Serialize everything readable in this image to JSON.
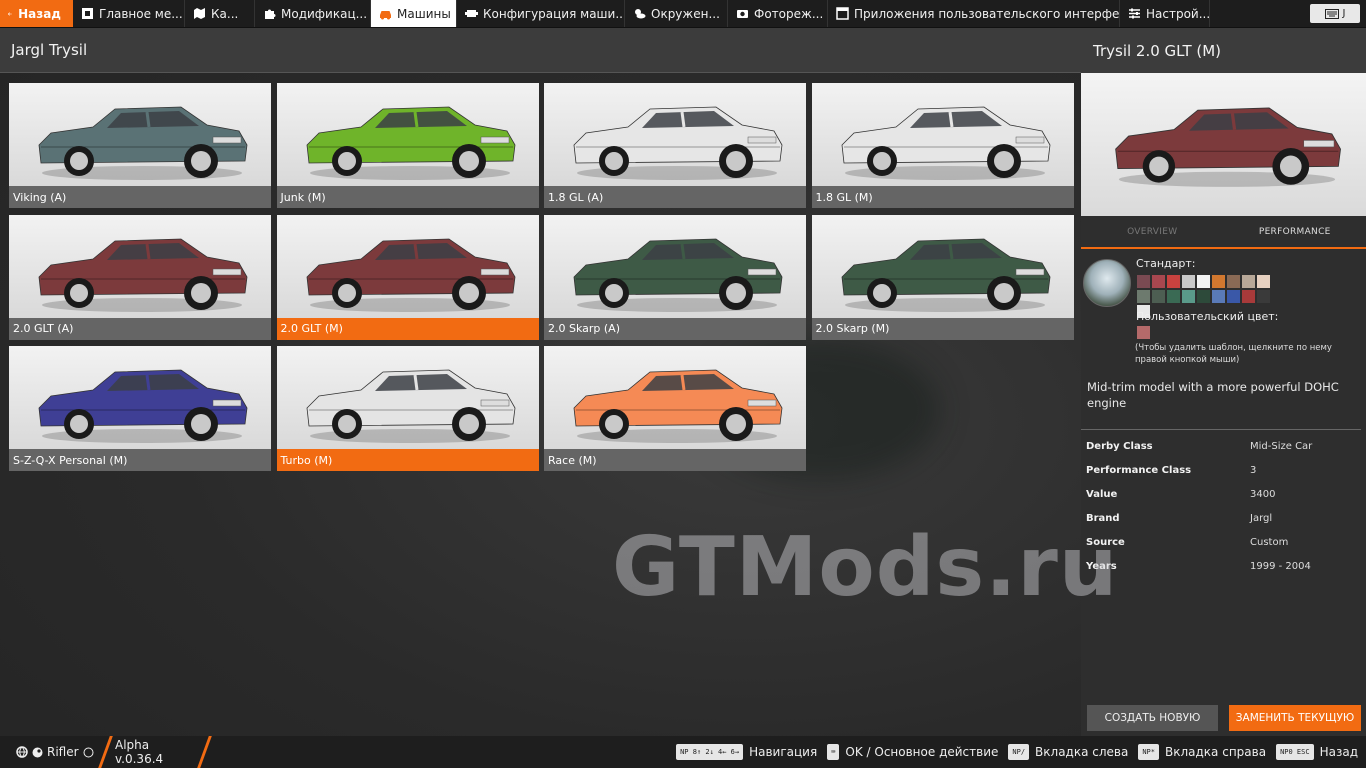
{
  "topbar": {
    "back_label": "Назад",
    "tabs": [
      {
        "label": "Главное ме...",
        "icon": "home-icon"
      },
      {
        "label": "Ка...",
        "icon": "map-icon"
      },
      {
        "label": "Модификац...",
        "icon": "puzzle-icon"
      },
      {
        "label": "Машины",
        "icon": "car-icon",
        "active": true
      },
      {
        "label": "Конфигурация маши...",
        "icon": "engine-icon"
      },
      {
        "label": "Окружен...",
        "icon": "weather-icon"
      },
      {
        "label": "Фотореж...",
        "icon": "camera-icon"
      },
      {
        "label": "Приложения пользовательского интерфе...",
        "icon": "apps-icon"
      },
      {
        "label": "Настрой...",
        "icon": "settings-icon"
      }
    ],
    "user_badge": "J"
  },
  "list": {
    "title": "Jargl Trysil",
    "cards": [
      {
        "label": "Viking (A)",
        "color": "#5a7275",
        "selected": false
      },
      {
        "label": "Junk (M)",
        "color": "#6fb42a",
        "selected": false
      },
      {
        "label": "1.8 GL (A)",
        "color": "#e6e6e6",
        "selected": false
      },
      {
        "label": "1.8 GL (M)",
        "color": "#e6e6e6",
        "selected": false
      },
      {
        "label": "2.0 GLT (A)",
        "color": "#7c3a3c",
        "selected": false
      },
      {
        "label": "2.0 GLT (M)",
        "color": "#7c3a3c",
        "selected": true
      },
      {
        "label": "2.0 Skarp (A)",
        "color": "#3e5a46",
        "selected": false
      },
      {
        "label": "2.0 Skarp (M)",
        "color": "#3e5a46",
        "selected": false
      },
      {
        "label": "S-Z-Q-X Personal (M)",
        "color": "#3f3f95",
        "selected": false
      },
      {
        "label": "Turbo (M)",
        "color": "#e4e4e4",
        "selected": true
      },
      {
        "label": "Race (M)",
        "color": "#f58a55",
        "selected": false
      }
    ]
  },
  "detail": {
    "title": "Trysil 2.0 GLT (M)",
    "preview_color": "#7c3a3c",
    "tabs": [
      "OVERVIEW",
      "PERFORMANCE"
    ],
    "active_tab": "PERFORMANCE",
    "paint_standard_label": "Стандарт:",
    "swatches": [
      "#7a4a52",
      "#a8474f",
      "#c8423f",
      "#c9c9c9",
      "#f3f3f3",
      "#d2782f",
      "#8a6a55",
      "#b8a898",
      "#e6d0c0",
      "#6d7a6e",
      "#4d5e52",
      "#3a6a54",
      "#5a9a8a",
      "#2d4a3a",
      "#5a7ab8",
      "#3a58a8",
      "#a83a3a",
      "#3a3a3a",
      "#e8e8e8"
    ],
    "paint_custom_label": "Пользовательский цвет:",
    "custom_swatch": "#b56a6a",
    "paint_hint": "(Чтобы удалить шаблон, щелкните по нему правой кнопкой мыши)",
    "description": "Mid-trim model with a more powerful DOHC engine",
    "specs": [
      {
        "key": "Derby Class",
        "value": "Mid-Size Car"
      },
      {
        "key": "Performance Class",
        "value": "3"
      },
      {
        "key": "Value",
        "value": "3400"
      },
      {
        "key": "Brand",
        "value": "Jargl"
      },
      {
        "key": "Source",
        "value": "Custom"
      },
      {
        "key": "Years",
        "value": "1999 - 2004"
      }
    ],
    "create_button": "СОЗДАТЬ НОВУЮ",
    "replace_button": "ЗАМЕНИТЬ ТЕКУЩУЮ"
  },
  "watermark": "GTMods.ru",
  "bottombar": {
    "user": "Rifler",
    "version": "Alpha v.0.36.4",
    "hints": [
      {
        "keys": "NP 8↑ 2↓ 4← 6→",
        "label": "Навигация"
      },
      {
        "keys": "⌨",
        "label": "OK / Основное действие"
      },
      {
        "keys": "NP/",
        "label": "Вкладка слева"
      },
      {
        "keys": "NP*",
        "label": "Вкладка справа"
      },
      {
        "keys": "NP0  ESC",
        "label": "Назад"
      }
    ]
  }
}
